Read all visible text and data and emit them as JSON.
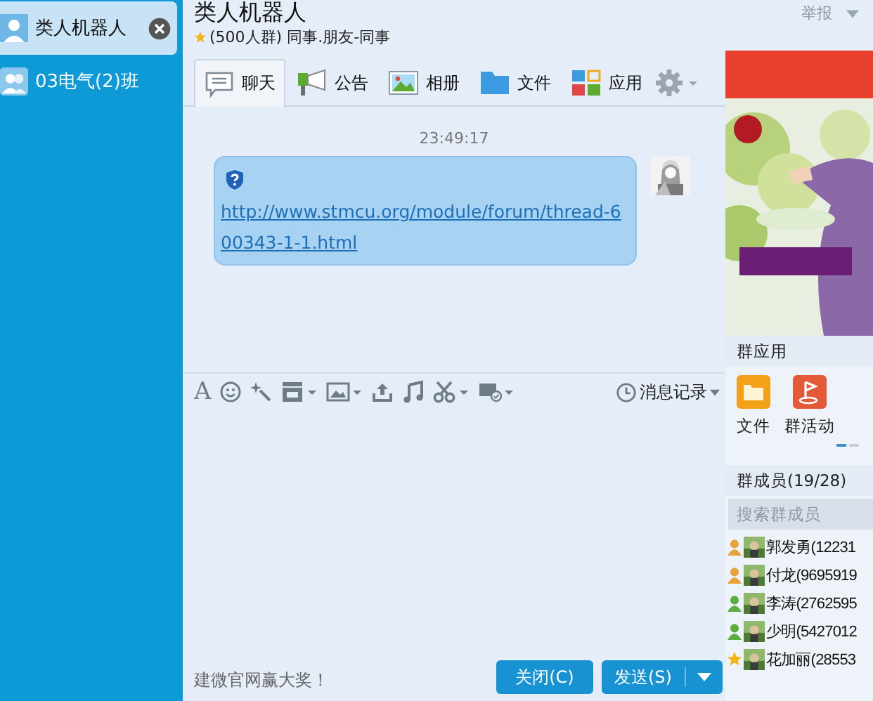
{
  "sidebar": {
    "items": [
      {
        "name": "类人机器人",
        "selected": true,
        "kind": "contact"
      },
      {
        "name": "03电气(2)班",
        "selected": false,
        "kind": "group"
      }
    ]
  },
  "header": {
    "title": "类人机器人",
    "subtitle": "(500人群) 同事.朋友-同事",
    "report": "举报"
  },
  "tabs": [
    {
      "label": "聊天",
      "selected": true
    },
    {
      "label": "公告",
      "selected": false
    },
    {
      "label": "相册",
      "selected": false
    },
    {
      "label": "文件",
      "selected": false
    },
    {
      "label": "应用",
      "selected": false
    }
  ],
  "messages": [
    {
      "time": "23:49:17",
      "link": "http://www.stmcu.org/module/forum/thread-600343-1-1.html"
    }
  ],
  "toolbar": {
    "font_glyph": "A",
    "history": "消息记录"
  },
  "footer": {
    "promo": "建微官网赢大奖！",
    "close": "关闭(C)",
    "send": "发送(S)"
  },
  "apps": {
    "title": "群应用",
    "items": [
      {
        "label": "文件"
      },
      {
        "label": "群活动"
      }
    ]
  },
  "members": {
    "title": "群成员(19/28)",
    "placeholder": "搜索群成员",
    "items": [
      {
        "name": "郭发勇(12231",
        "kind": "admin"
      },
      {
        "name": "付龙(9695919",
        "kind": "admin"
      },
      {
        "name": "李涛(2762595",
        "kind": "member"
      },
      {
        "name": "少明(5427012",
        "kind": "member"
      },
      {
        "name": "花加丽(28553",
        "kind": "owner"
      }
    ]
  }
}
